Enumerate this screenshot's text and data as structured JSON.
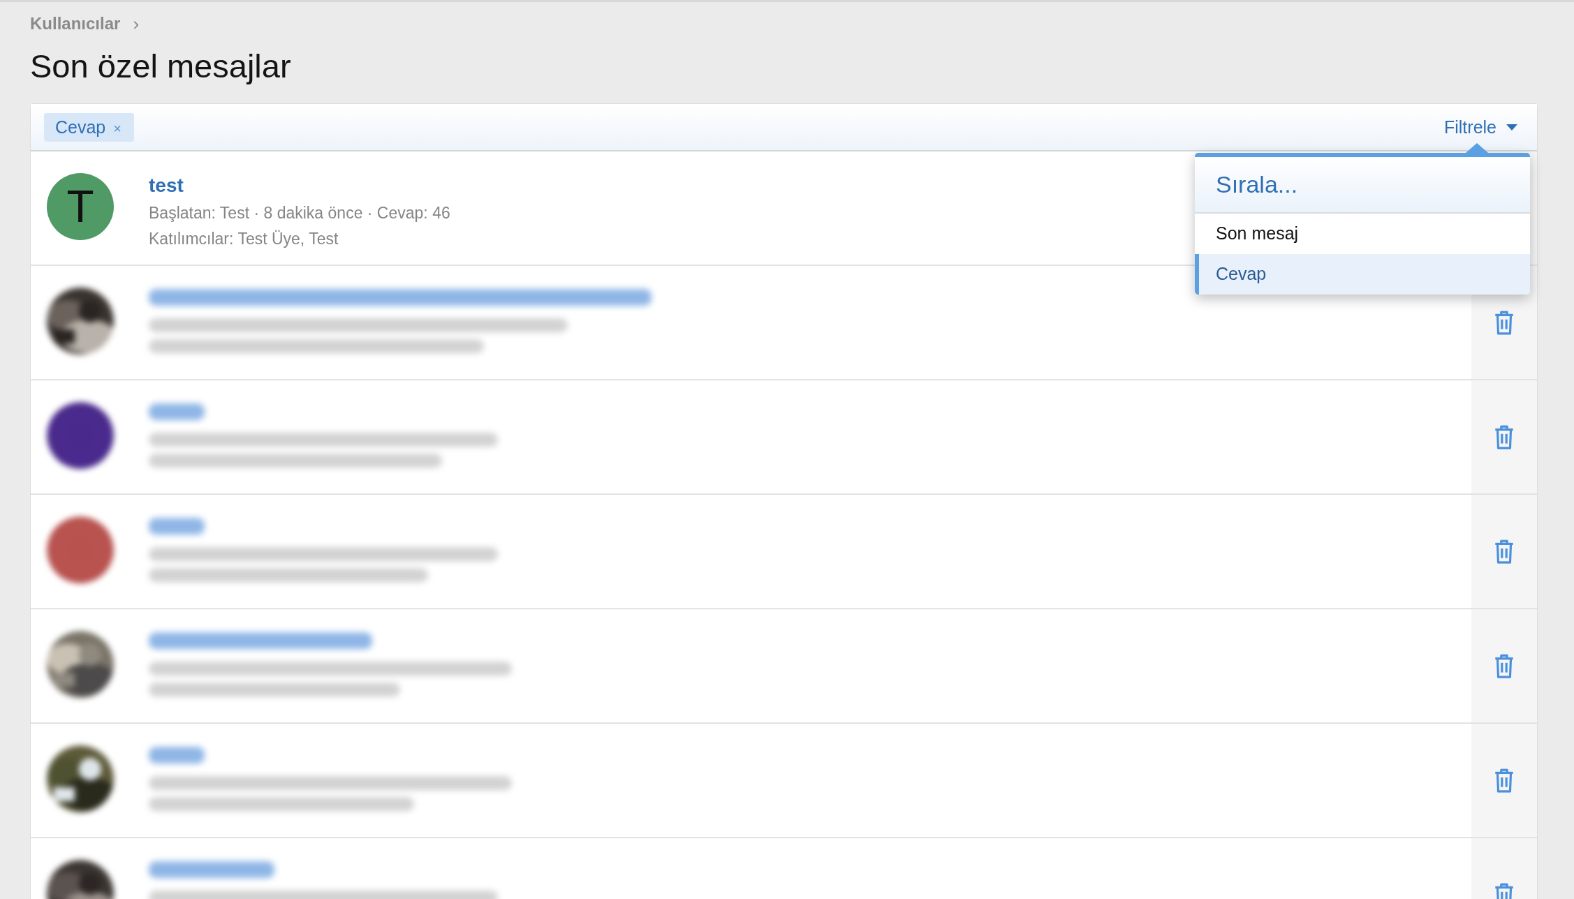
{
  "breadcrumb": {
    "items": [
      "Kullanıcılar"
    ],
    "separator": "›"
  },
  "title": "Son özel mesajlar",
  "filter_bar": {
    "active_filters": [
      {
        "label": "Cevap",
        "remove": "×"
      }
    ],
    "menu_button": "Filtrele"
  },
  "sort_menu": {
    "title": "Sırala...",
    "options": [
      {
        "label": "Son mesaj",
        "selected": false
      },
      {
        "label": "Cevap",
        "selected": true
      }
    ]
  },
  "conversations": [
    {
      "kind": "plain",
      "avatar_letter": "T",
      "color": "#4f9a65",
      "title": "test",
      "meta": "Başlatan: Test · 8 dakika önce · Cevap: 46",
      "participants": "Katılımcılar: Test Üye, Test"
    },
    {
      "kind": "blurred_photo",
      "color": "#3a3430",
      "delete_icon": true
    },
    {
      "kind": "blurred_letter",
      "color": "#4a2a8c",
      "delete_icon": true
    },
    {
      "kind": "blurred_letter",
      "color": "#b8534f",
      "delete_icon": true
    },
    {
      "kind": "blurred_photo",
      "color": "#7a7468",
      "delete_icon": true
    },
    {
      "kind": "blurred_photo",
      "color": "#5d5a3a",
      "delete_icon": true
    },
    {
      "kind": "blurred_photo",
      "color": "#3c3633",
      "delete_icon": true
    }
  ]
}
